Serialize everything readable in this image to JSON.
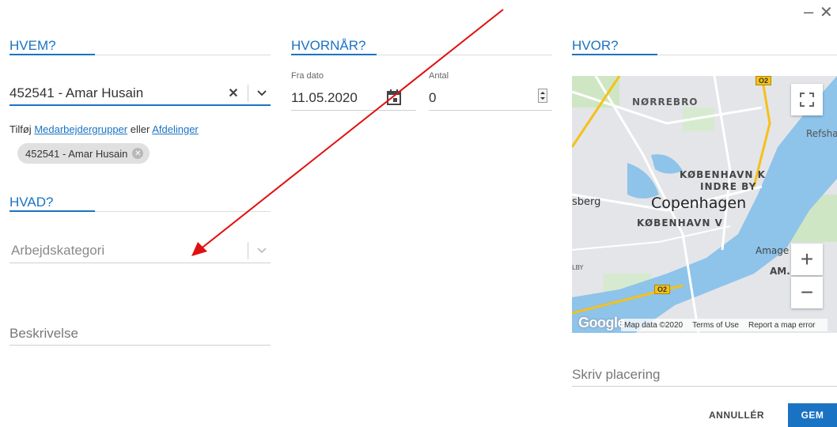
{
  "window": {
    "minimize_icon": "minimize-icon",
    "close_icon": "close-icon",
    "minimize_glyph": "–",
    "close_glyph": "✕"
  },
  "who": {
    "title": "HVEM?",
    "selected_value": "452541 - Amar Husain",
    "add_prefix": "Tilføj",
    "add_link_groups": "Medarbejdergrupper",
    "add_middle": "eller",
    "add_link_departments": "Afdelinger",
    "chip_label": "452541 - Amar Husain"
  },
  "what": {
    "title": "HVAD?",
    "category_placeholder": "Arbejdskategori",
    "description_placeholder": "Beskrivelse"
  },
  "when": {
    "title": "HVORNÅR?",
    "from_date_label": "Fra dato",
    "from_date_value": "11.05.2020",
    "amount_label": "Antal",
    "amount_value": "0"
  },
  "where": {
    "title": "HVOR?",
    "location_placeholder": "Skriv placering",
    "map": {
      "labels": {
        "norrebro": "NØRREBRO",
        "refshale": "Refshale",
        "kobenhavn_k": "KØBENHAVN K",
        "indre_by": "INDRE BY",
        "sberg": "sberg",
        "copenhagen": "Copenhagen",
        "kobenhavn_v": "KØBENHAVN V",
        "amager": "Amage",
        "am": "AM.",
        "lby": "LBY",
        "route_o2": "O2"
      },
      "google_logo": "Google",
      "footer": {
        "map_data": "Map data ©2020",
        "terms": "Terms of Use",
        "report": "Report a map error"
      },
      "zoom_in": "+",
      "zoom_out": "−"
    }
  },
  "actions": {
    "cancel_label": "ANNULLÉR",
    "save_label": "GEM"
  },
  "colors": {
    "accent": "#1a73c2",
    "annotation_arrow": "#e01010"
  }
}
